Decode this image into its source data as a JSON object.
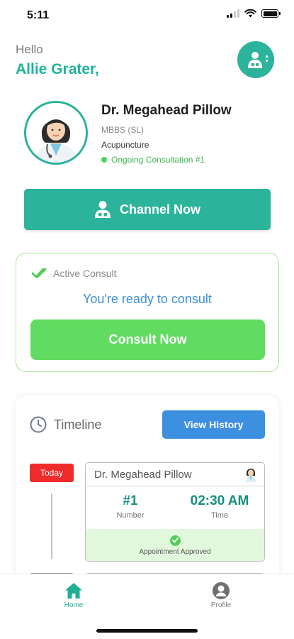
{
  "status_bar": {
    "time": "5:11"
  },
  "header": {
    "greeting": "Hello",
    "user_name": "Allie Grater,",
    "switch_icon": "doctor-switch-icon"
  },
  "doctor": {
    "name": "Dr. Megahead Pillow",
    "degree": "MBBS (SL)",
    "specialty": "Acupuncture",
    "consultation_status": "Ongoing Consultation #1",
    "avatar_icon": "doctor-avatar-icon"
  },
  "channel_button": {
    "label": "Channel Now",
    "icon": "doctor-icon"
  },
  "active_consult": {
    "title": "Active Consult",
    "message": "You're ready to consult",
    "button_label": "Consult Now"
  },
  "timeline": {
    "title": "Timeline",
    "history_button": "View History",
    "today_label": "Today",
    "appointment": {
      "doctor_name": "Dr. Megahead Pillow",
      "number": "#1",
      "number_caption": "Number",
      "time": "02:30 AM",
      "time_caption": "Time",
      "status": "Appointment Approved"
    }
  },
  "bottom_nav": {
    "items": [
      {
        "label": "Home",
        "icon": "home-icon",
        "active": true
      },
      {
        "label": "Profile",
        "icon": "profile-icon",
        "active": false
      }
    ]
  },
  "colors": {
    "primary": "#2bb39b",
    "accent_green": "#61dc60",
    "accent_blue": "#3d8fe0",
    "today_red": "#f02b2b"
  }
}
